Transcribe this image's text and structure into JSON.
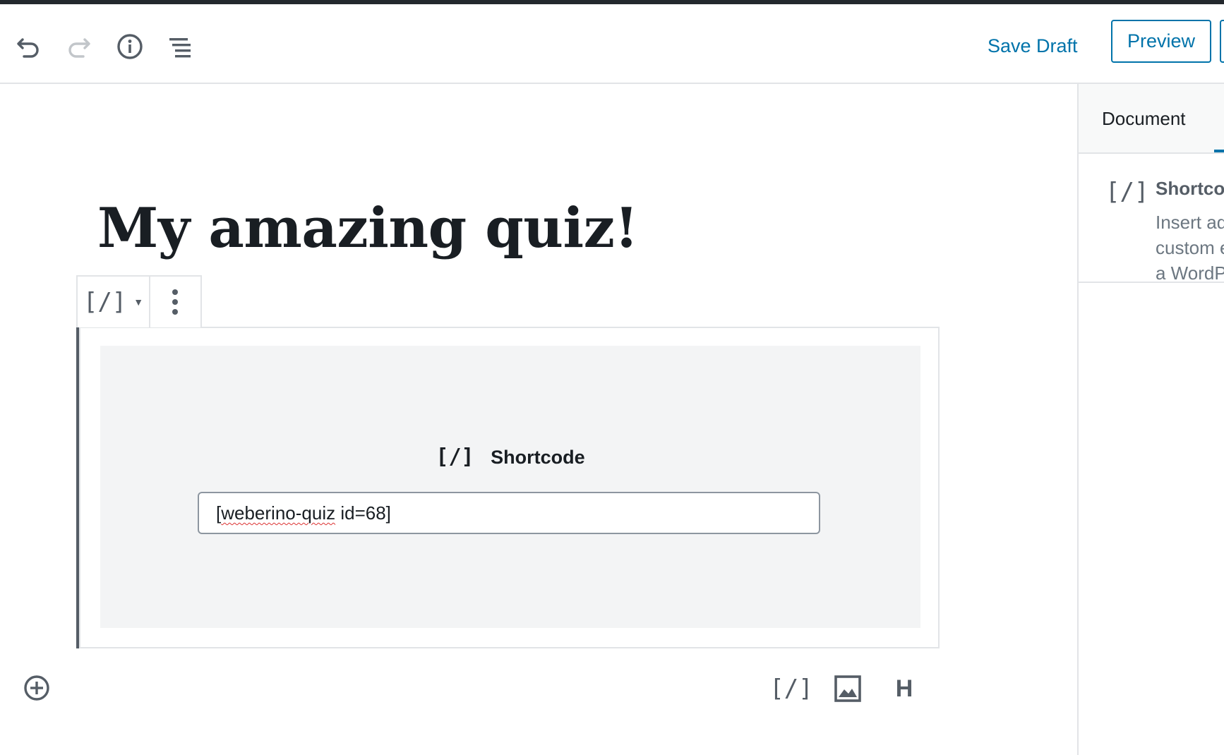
{
  "header": {
    "undo_icon": "undo-icon",
    "redo_icon": "redo-icon",
    "info_icon": "info-icon",
    "outline_icon": "list-icon",
    "save_draft_label": "Save Draft",
    "preview_label": "Preview"
  },
  "sidebar": {
    "tab_document": "Document",
    "block_card": {
      "icon": "[/]",
      "title": "Shortcode",
      "description": "Insert additional custom elements with a WordPress shortcode."
    }
  },
  "editor": {
    "post_title": "My amazing quiz!",
    "block_toolbar": {
      "switcher_icon": "[/]",
      "more_icon": "more-vertical-icon"
    },
    "shortcode_block": {
      "icon": "[/]",
      "label": "Shortcode",
      "value_misspelled": "weberino-quiz",
      "value_prefix": "[",
      "value_suffix": " id=68]"
    },
    "inserter_icon": "plus-circle-icon",
    "quick_inserter": {
      "shortcode_icon": "[/]",
      "image_icon": "image-icon",
      "heading_icon": "H"
    }
  },
  "colors": {
    "accent": "#0073aa",
    "dark_bar": "#23282d",
    "block_border": "#e2e4e7",
    "placeholder_bg": "#f3f4f5"
  }
}
